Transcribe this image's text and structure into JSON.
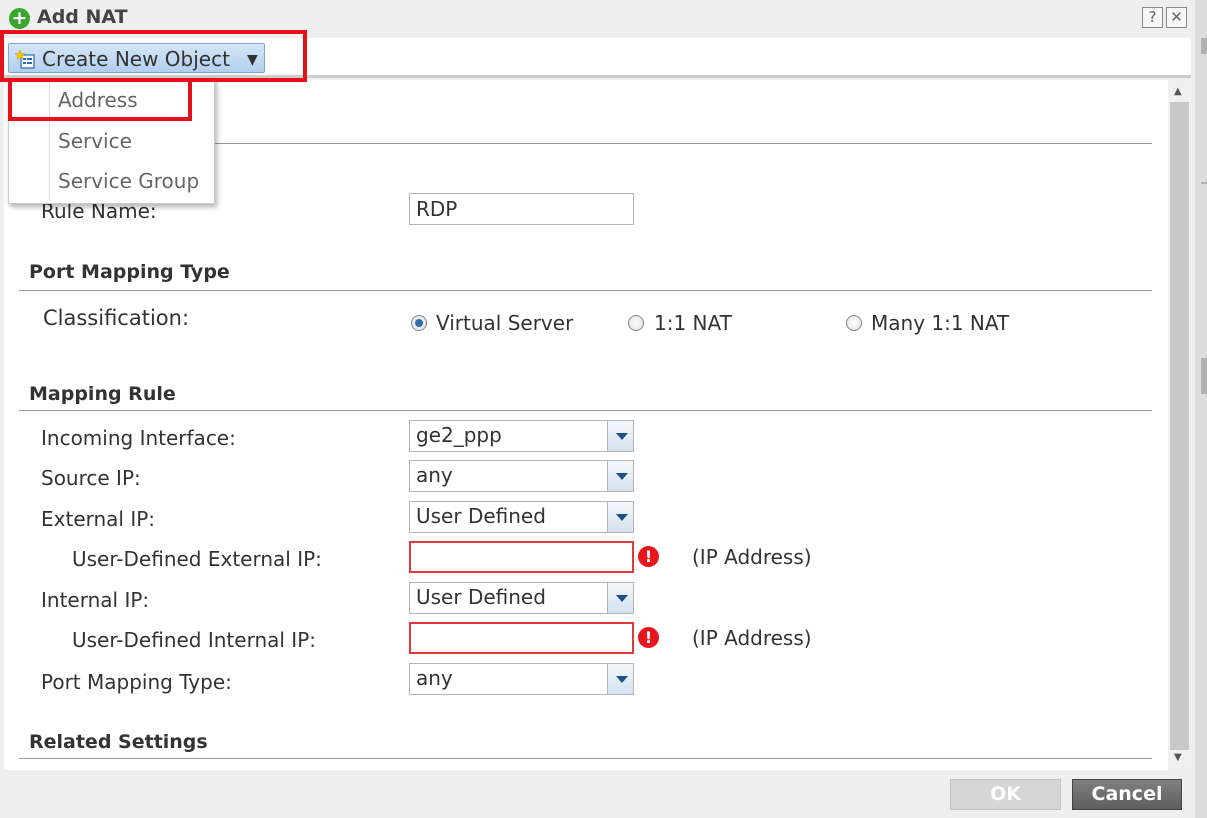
{
  "window": {
    "title": "Add NAT",
    "help_label": "?",
    "close_label": "✕"
  },
  "toolbar": {
    "create_label": "Create New Object",
    "caret": "▼"
  },
  "dropdown_menu": {
    "items": [
      "Address",
      "Service",
      "Service Group"
    ]
  },
  "general": {
    "rule_name_label": "Rule Name:",
    "rule_name_value": "RDP"
  },
  "port_mapping_type": {
    "title": "Port Mapping Type",
    "classification_label": "Classification:",
    "options": [
      "Virtual Server",
      "1:1 NAT",
      "Many 1:1 NAT"
    ],
    "selected": "Virtual Server"
  },
  "mapping_rule": {
    "title": "Mapping Rule",
    "incoming_interface_label": "Incoming Interface:",
    "incoming_interface_value": "ge2_ppp",
    "source_ip_label": "Source IP:",
    "source_ip_value": "any",
    "external_ip_label": "External IP:",
    "external_ip_value": "User Defined",
    "user_defined_external_ip_label": "User-Defined External IP:",
    "user_defined_external_ip_value": "",
    "ip_address_hint": "(IP Address)",
    "internal_ip_label": "Internal IP:",
    "internal_ip_value": "User Defined",
    "user_defined_internal_ip_label": "User-Defined Internal IP:",
    "user_defined_internal_ip_value": "",
    "port_mapping_type_label": "Port Mapping Type:",
    "port_mapping_type_value": "any"
  },
  "related_settings": {
    "title": "Related Settings"
  },
  "footer": {
    "ok_label": "OK",
    "cancel_label": "Cancel"
  },
  "colors": {
    "highlight_border": "#e8111b",
    "error_border": "#e23a3a",
    "accent_blue": "#2d6fb0"
  },
  "icons": [
    "add-circle-icon",
    "help-icon",
    "close-icon",
    "create-object-icon",
    "chevron-down-icon",
    "error-icon"
  ]
}
